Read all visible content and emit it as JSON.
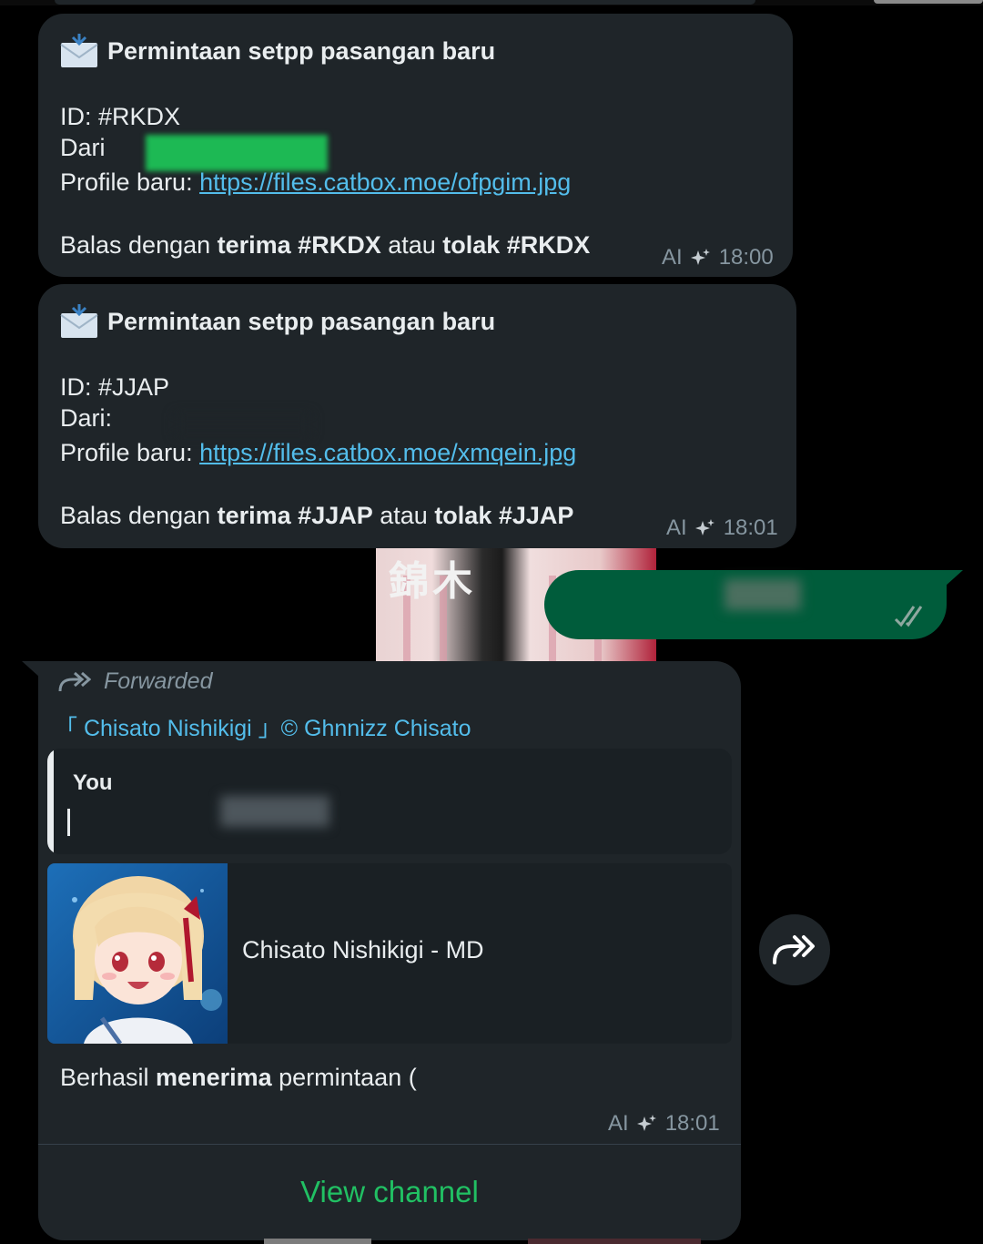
{
  "messages": [
    {
      "title": "Permintaan setpp pasangan baru",
      "id_line": "ID: #RKDX",
      "from_label": "Dari",
      "profile_label": "Profile baru: ",
      "profile_url": "https://files.catbox.moe/ofpgim.jpg",
      "reply_prefix": "Balas dengan ",
      "accept_cmd": "terima #RKDX",
      "or_word": " atau ",
      "reject_cmd": "tolak #RKDX",
      "ai_label": "AI",
      "time": "18:00"
    },
    {
      "title": "Permintaan setpp pasangan baru",
      "id_line": "ID: #JJAP",
      "from_label": "Dari:",
      "profile_label": "Profile baru: ",
      "profile_url": "https://files.catbox.moe/xmqein.jpg",
      "reply_prefix": "Balas dengan ",
      "accept_cmd": "terima #JJAP",
      "or_word": " atau ",
      "reject_cmd": "tolak #JJAP",
      "ai_label": "AI",
      "time": "18:01"
    }
  ],
  "background_image": {
    "kanji": "錦木"
  },
  "forwarded_message": {
    "forwarded_label": "Forwarded",
    "channel_name": "「 Chisato Nishikigi 」© Ghnnizz Chisato",
    "quote_author": "You",
    "preview_title": "Chisato Nishikigi - MD",
    "body_prefix": "Berhasil ",
    "body_bold": "menerima",
    "body_suffix": " permintaan (",
    "ai_label": "AI",
    "time": "18:01",
    "action_label": "View channel"
  },
  "icons": {
    "envelope": "envelope-icon",
    "ai_sparkle": "ai-sparkle-icon",
    "forward": "forward-arrow-icon",
    "double_check": "double-check-icon",
    "share": "share-forward-icon"
  },
  "colors": {
    "bubble_incoming": "#1f2529",
    "bubble_outgoing": "#005c3b",
    "link": "#53bdeb",
    "action_green": "#21c063",
    "meta_grey": "#8696a0"
  }
}
